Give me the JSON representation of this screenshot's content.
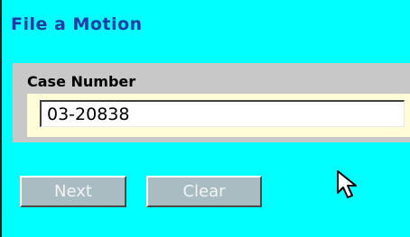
{
  "page": {
    "title": "File a Motion"
  },
  "form": {
    "case_number_label": "Case Number",
    "case_number_value": "03-20838"
  },
  "buttons": {
    "next_label": "Next",
    "clear_label": "Clear"
  },
  "colors": {
    "background": "#00ffff",
    "title": "#1a3ba8",
    "section": "#c8c8c8",
    "input_well": "#fffdd8",
    "button": "#a9bcc1"
  },
  "icons": {
    "cursor": "mouse-pointer-icon"
  }
}
